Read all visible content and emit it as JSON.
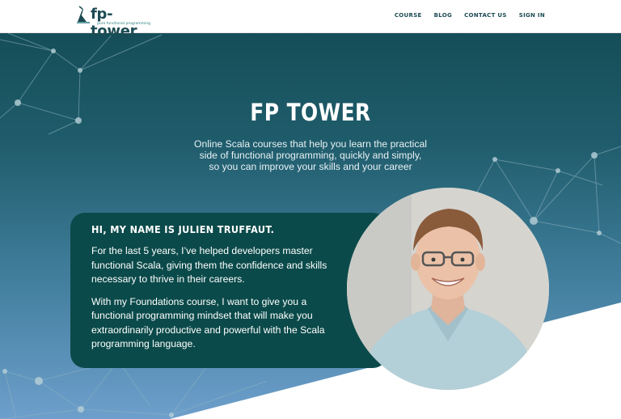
{
  "brand": {
    "name": "fp-tower",
    "tagline": "pure functional programming",
    "colors": {
      "primary": "#1d4b53",
      "accent": "#2d8080",
      "card": "#0b4a4a"
    }
  },
  "nav": {
    "items": [
      {
        "label": "COURSE"
      },
      {
        "label": "BLOG"
      },
      {
        "label": "CONTACT US"
      },
      {
        "label": "SIGN IN"
      }
    ]
  },
  "hero": {
    "title": "FP TOWER",
    "subtitle_lines": [
      "Online Scala courses that help you learn the practical",
      "side of functional programming, quickly and simply,",
      "so you can improve your skills and your career"
    ]
  },
  "intro": {
    "heading": "HI, MY NAME IS JULIEN TRUFFAUT.",
    "paragraphs": [
      "For the last 5 years, I’ve helped developers master functional Scala, giving them the confidence and skills necessary to thrive in their careers.",
      "With my Foundations course, I want to give you a functional programming mindset that will make you extraordinarily productive and powerful with the Scala programming language."
    ]
  }
}
